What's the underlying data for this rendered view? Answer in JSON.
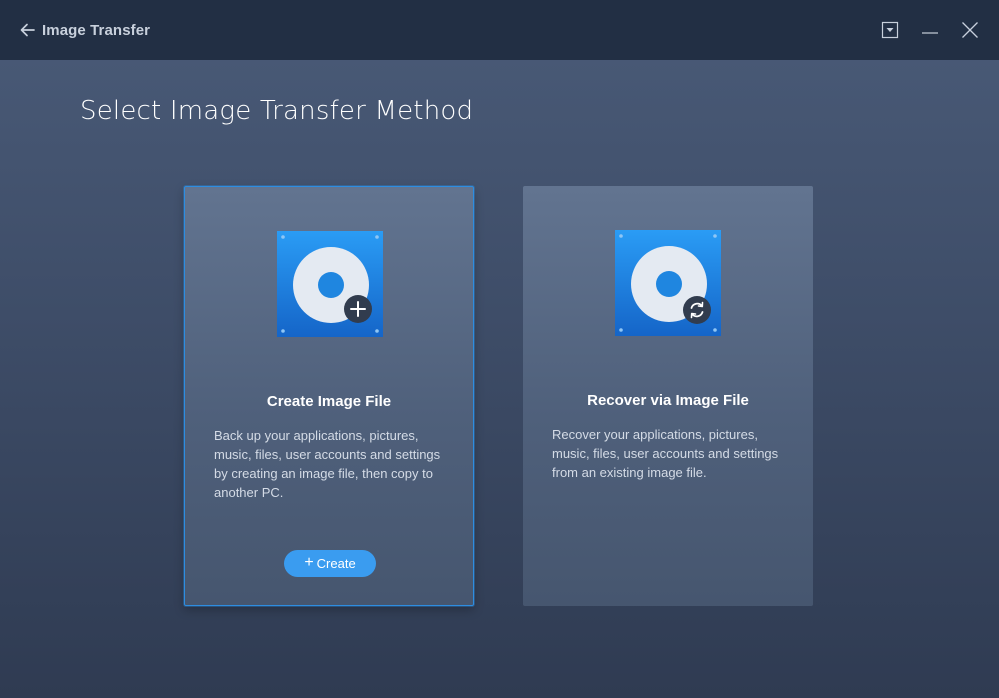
{
  "window": {
    "title": "Image Transfer",
    "back_icon": "arrow-left-icon",
    "controls": [
      "dropdown-menu-icon",
      "minimize-icon",
      "close-icon"
    ]
  },
  "page": {
    "title": "Select Image Transfer Method"
  },
  "cards": [
    {
      "title": "Create Image File",
      "description": "Back up your applications, pictures, music, files, user accounts and settings by creating an image file, then copy to another PC.",
      "icon": "disc-add-icon",
      "selected": true,
      "button": {
        "icon": "plus-icon",
        "label": "Create"
      }
    },
    {
      "title": "Recover via Image File",
      "description": "Recover your applications, pictures, music, files, user accounts and settings from an existing image file.",
      "icon": "disc-recover-icon",
      "selected": false
    }
  ],
  "colors": {
    "titlebar": "#222f44",
    "accent": "#3a9cf0",
    "selected_border": "#2e8de0"
  }
}
